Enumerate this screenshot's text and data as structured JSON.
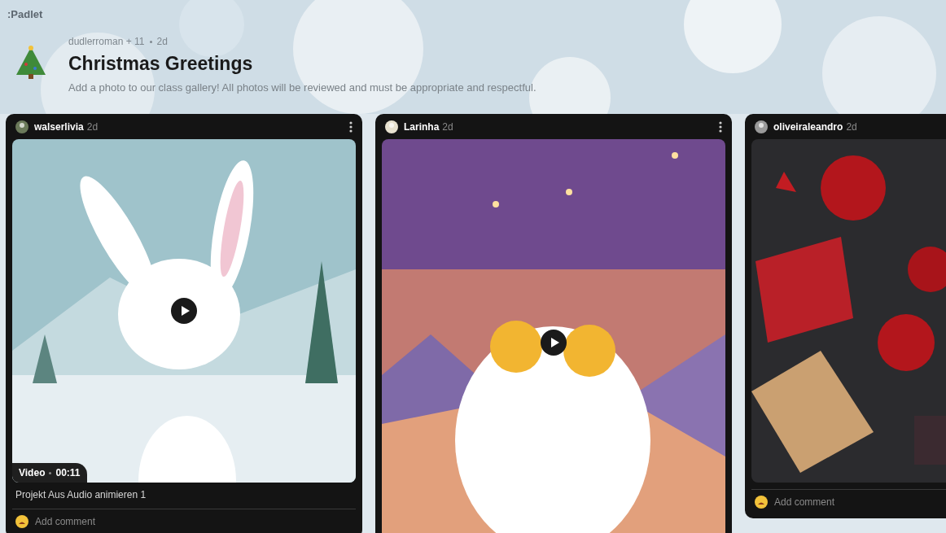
{
  "app": {
    "logo": ":Padlet"
  },
  "header": {
    "authors": "dudlerroman + 11",
    "time": "2d",
    "title": "Christmas Greetings",
    "description": "Add a photo to our class gallery! All photos will be reviewed and must be appropriate and respectful."
  },
  "posts": [
    {
      "author": "walserlivia",
      "time": "2d",
      "media": {
        "kind": "video",
        "label": "Video",
        "duration": "00:11"
      },
      "caption": "Projekt Aus Audio animieren 1",
      "comment_placeholder": "Add comment"
    },
    {
      "author": "Larinha",
      "time": "2d",
      "media": {
        "kind": "video"
      }
    },
    {
      "author": "oliveiraleandro",
      "time": "2d",
      "comment_placeholder": "Add comment"
    }
  ]
}
